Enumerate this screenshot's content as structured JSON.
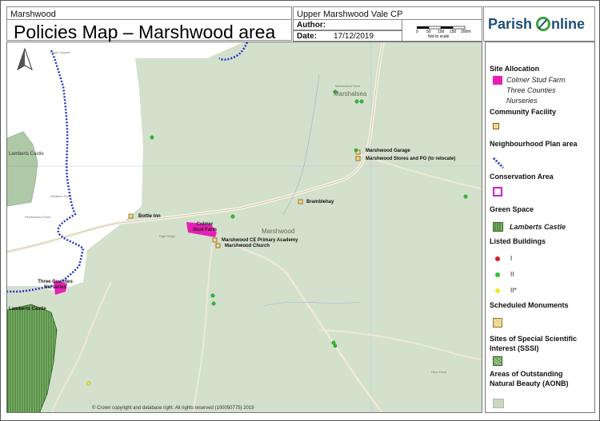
{
  "header": {
    "area_name": "Marshwood",
    "map_title": "Policies Map – Marshwood area",
    "parish": "Upper Marshwood Vale CP",
    "author_label": "Author:",
    "author_value": "",
    "date_label": "Date:",
    "date_value": "17/12/2019",
    "scale_ticks": [
      "0",
      "50",
      "100",
      "150",
      "200m"
    ],
    "scale_note": "Not to scale",
    "brand_left": "Parish",
    "brand_right": "nline"
  },
  "map": {
    "site_labels": {
      "bottle_inn": "Bottle Inn",
      "colmer": "Colmer Stud Farm",
      "three_counties": "Three Counties Nurseries",
      "primary_academy": "Marshwood CE Primary Academy",
      "church": "Marshwood Church",
      "bramblehay": "Bramblehay",
      "garage": "Marshwood Garage",
      "stores": "Marshwood Stores and PO (to relocate)",
      "lamberts_west": "Lamberts Castle",
      "lamberts_south": "Lamberts Castle"
    },
    "place_names": {
      "marshalsea": "Marshalsea",
      "marshwood": "Marshwood"
    },
    "copyright": "© Crown copyright and database right. All rights reserved (100050775) 2019"
  },
  "legend": {
    "site_allocation": "Site Allocation",
    "site_allocation_items": [
      "Colmer Stud Farm",
      "Three Counties",
      "Nurseries"
    ],
    "community_facility": "Community Facility",
    "neighbourhood_plan_area": "Neighbourhood Plan area",
    "conservation_area": "Conservation Area",
    "green_space": "Green Space",
    "lamberts_castle": "Lamberts Castle",
    "listed_buildings": "Listed Buildings",
    "listed_grades": [
      "I",
      "II",
      "II*"
    ],
    "scheduled_monuments": "Scheduled Monuments",
    "sssi_line1": "Sites of Special Scientific",
    "sssi_line2": "Interest (SSSI)",
    "aonb_line1": "Areas of Outstanding",
    "aonb_line2": "Natural Beauty (AONB)"
  },
  "colors": {
    "allocation": "#e81fb4",
    "green_space": "#d21fcf",
    "conservation": "#2330c9",
    "community": "#c98a1d",
    "grade_i": "#e11c1c",
    "grade_ii": "#2fc02f",
    "grade_iistar": "#f1ea20",
    "aonb": "#c9d8c3",
    "map_bg": "#d3e0cc"
  }
}
